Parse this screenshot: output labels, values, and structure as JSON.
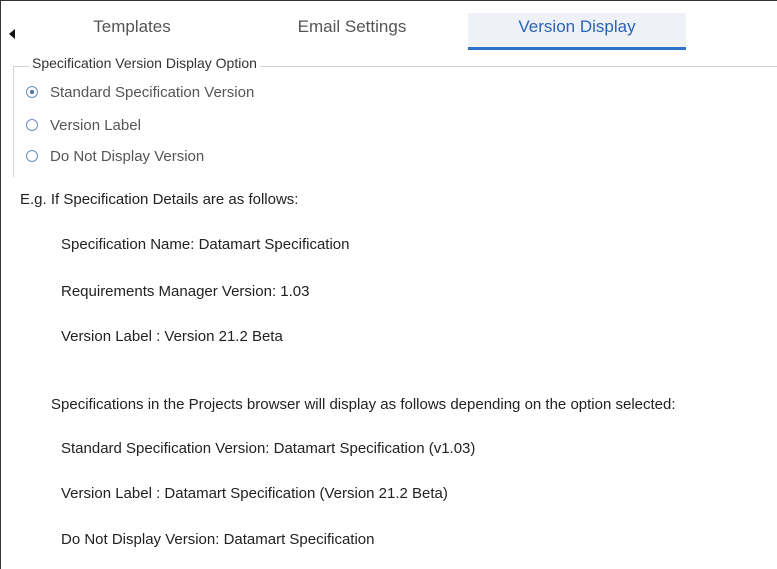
{
  "tabs": {
    "templates": "Templates",
    "email_settings": "Email Settings",
    "version_display": "Version Display"
  },
  "option_group": {
    "legend": "Specification Version Display Option",
    "options": [
      {
        "label": "Standard Specification Version",
        "selected": true
      },
      {
        "label": "Version Label",
        "selected": false
      },
      {
        "label": "Do Not Display Version",
        "selected": false
      }
    ]
  },
  "example": {
    "intro": "E.g. If Specification Details are as follows:",
    "spec_name": "Specification Name: Datamart Specification",
    "rm_version": "Requirements Manager Version: 1.03",
    "version_label": "Version Label : Version 21.2 Beta",
    "display_intro": "Specifications in the Projects browser will display as follows depending on the option selected:",
    "display_standard": "Standard Specification Version: Datamart Specification (v1.03)",
    "display_label": "Version Label : Datamart Specification (Version 21.2 Beta)",
    "display_none": "Do Not Display Version: Datamart Specification"
  },
  "colors": {
    "active_tab_text": "#2b63b5",
    "active_tab_underline": "#2e73c9",
    "active_tab_bg": "#eef1f6"
  }
}
